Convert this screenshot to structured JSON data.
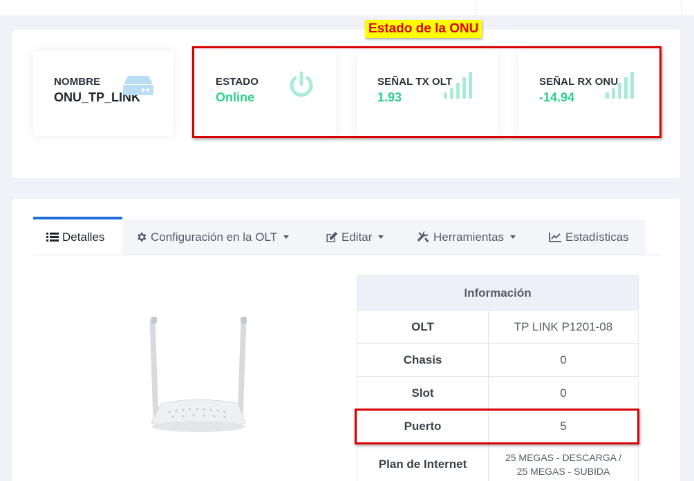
{
  "cards": [
    {
      "label": "NOMBRE",
      "value": "ONU_TP_LINK",
      "icon": "router-icon"
    },
    {
      "label": "ESTADO",
      "value": "Online",
      "icon": "power-icon"
    },
    {
      "label": "SEÑAL TX OLT",
      "value": "1.93",
      "icon": "signal-bars-icon"
    },
    {
      "label": "SEÑAL RX ONU",
      "value": "-14.94",
      "icon": "signal-bars-icon"
    }
  ],
  "annotation": {
    "label": "Estado de la ONU"
  },
  "tabs": [
    {
      "label": "Detalles",
      "icon": "list-icon",
      "active": true
    },
    {
      "label": "Configuración en la OLT",
      "icon": "gear-icon"
    },
    {
      "label": "Editar",
      "icon": "edit-icon"
    },
    {
      "label": "Herramientas",
      "icon": "tools-icon"
    },
    {
      "label": "Estadísticas",
      "icon": "chart-icon"
    }
  ],
  "info_table": {
    "header": "Información",
    "rows": [
      {
        "key": "OLT",
        "value": "TP LINK P1201-08"
      },
      {
        "key": "Chasis",
        "value": "0"
      },
      {
        "key": "Slot",
        "value": "0"
      },
      {
        "key": "Puerto",
        "value": "5"
      },
      {
        "key": "Plan de Internet",
        "value_line1": "25 MEGAS - DESCARGA /",
        "value_line2": "25 MEGAS - SUBIDA"
      }
    ]
  },
  "colors": {
    "accent": "#1e6fd9",
    "success": "#2ecf8d",
    "highlight": "#ffff00",
    "callout_red": "#d90000"
  }
}
